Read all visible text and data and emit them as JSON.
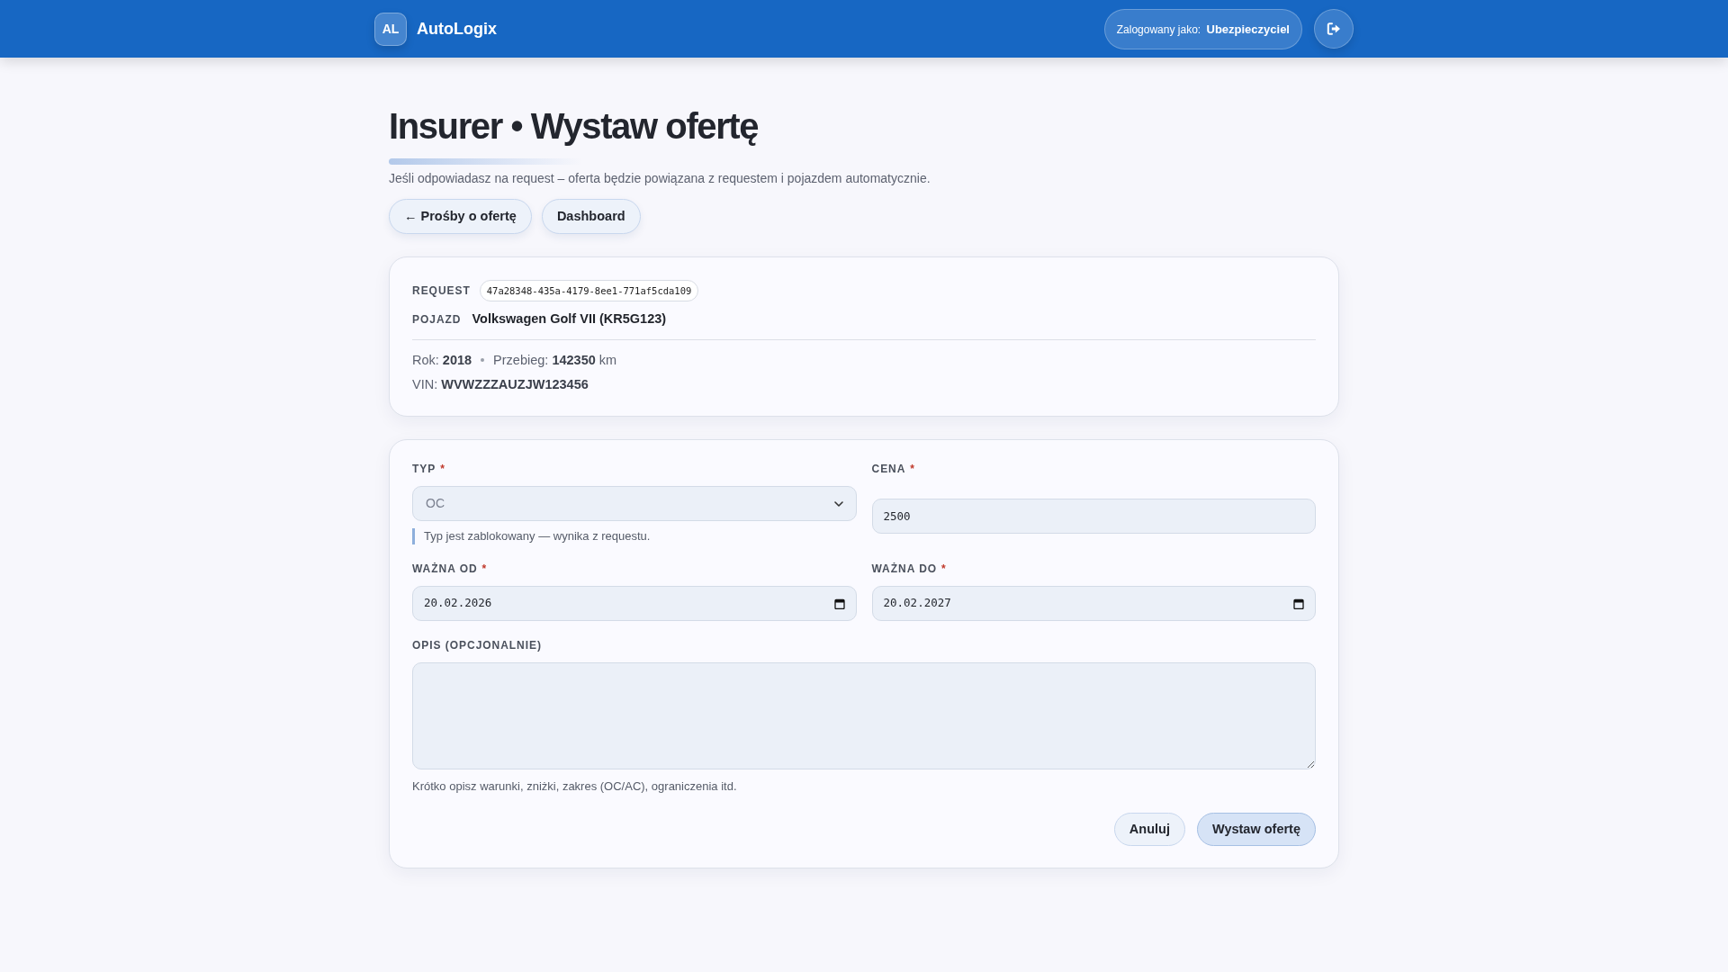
{
  "header": {
    "logo": "AL",
    "brand": "AutoLogix",
    "session": "Zalogowany jako: **Ubezpieczyciel**"
  },
  "page": {
    "title": "Insurer • Wystaw ofertę",
    "subtitle": "Jeśli odpowiadasz na request – oferta będzie powiązana z requestem i pojazdem automatycznie.",
    "nav_buttons": [
      "← Prośby o ofertę",
      "Dashboard"
    ]
  },
  "request_card": {
    "request": {
      "label": "REQUEST",
      "value": "47a28348-435a-4179-8ee1-771af5cda109"
    },
    "vehicle": {
      "label": "POJAZD",
      "value": "Volkswagen Golf VII (KR5G123)"
    },
    "specs": [
      "Rok: **2018**",
      "Przebieg: **142350** km"
    ],
    "vin": "VIN: **WVWZZZAUZJW123456**"
  },
  "offer_form": {
    "fields": [
      {
        "kind": "select",
        "label": "TYP",
        "required_mark": "*",
        "value": "OC",
        "disabled": true,
        "note": "Typ jest zablokowany — wynika z requestu."
      },
      {
        "kind": "text",
        "label": "CENA",
        "required_mark": "*",
        "value": "2500"
      },
      {
        "kind": "date",
        "label": "WAŻNA OD",
        "required_mark": "*",
        "value": "20.02.2026"
      },
      {
        "kind": "date",
        "label": "WAŻNA DO",
        "required_mark": "*",
        "value": "20.02.2027"
      },
      {
        "kind": "textarea",
        "label": "OPIS (OPCJONALNIE)",
        "hint": "Krótko opisz warunki, zniżki, zakres (OC/AC), ograniczenia itd."
      }
    ],
    "buttons": [
      {
        "label": "Anuluj",
        "kind": "secondary"
      },
      {
        "label": "Wystaw ofertę",
        "kind": "primary"
      }
    ]
  }
}
